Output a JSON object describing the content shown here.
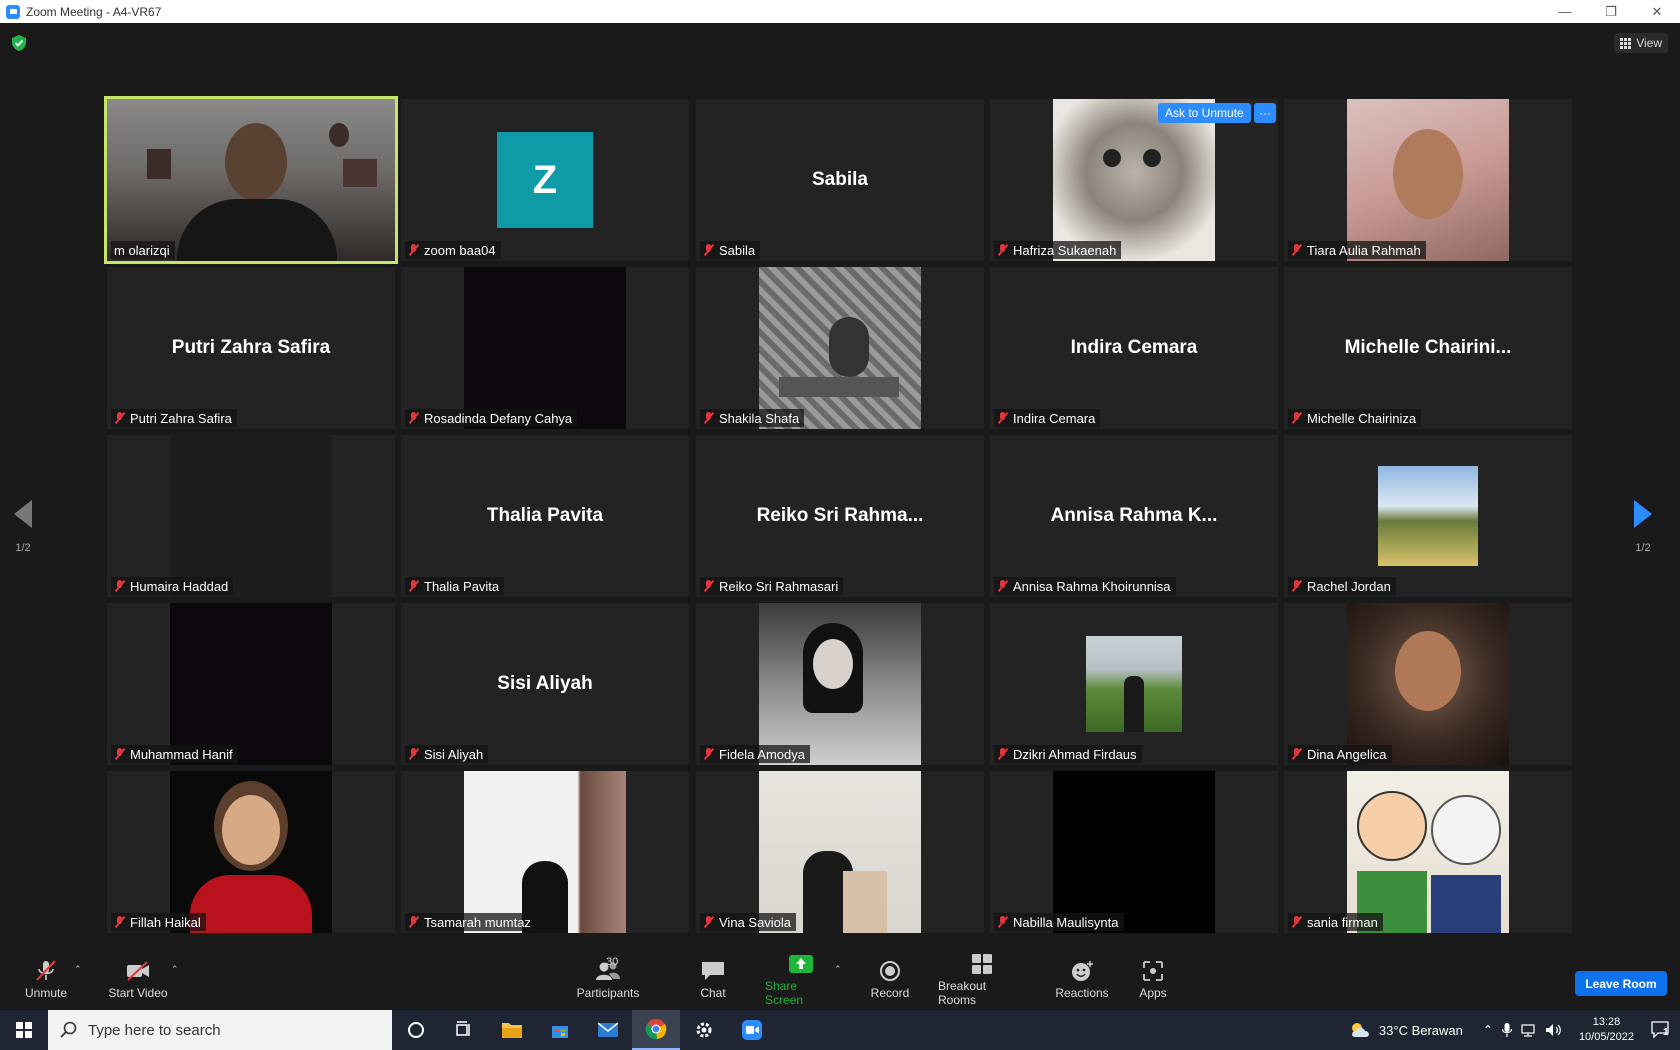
{
  "window": {
    "title": "Zoom Meeting - A4-VR67"
  },
  "top": {
    "view_label": "View"
  },
  "pagination": {
    "left": "1/2",
    "right": "1/2"
  },
  "tiles": [
    {
      "name": "m olarizqi",
      "center": "",
      "muted": false
    },
    {
      "name": "zoom baa04",
      "center": "",
      "avatar": "Z",
      "muted": true
    },
    {
      "name": "Sabila",
      "center": "Sabila",
      "muted": true
    },
    {
      "name": "Hafriza Sukaenah",
      "center": "",
      "muted": true,
      "ask_unmute": "Ask to Unmute",
      "more": "···"
    },
    {
      "name": "Tiara Aulia Rahmah",
      "center": "",
      "muted": true
    },
    {
      "name": "Putri Zahra Safira",
      "center": "Putri Zahra Safira",
      "muted": true
    },
    {
      "name": "Rosadinda Defany Cahya",
      "center": "",
      "muted": true
    },
    {
      "name": "Shakila Shafa",
      "center": "",
      "muted": true
    },
    {
      "name": "Indira Cemara",
      "center": "Indira Cemara",
      "muted": true
    },
    {
      "name": "Michelle Chairiniza",
      "center": "Michelle  Chairini...",
      "muted": true
    },
    {
      "name": "Humaira Haddad",
      "center": "",
      "muted": true
    },
    {
      "name": "Thalia Pavita",
      "center": "Thalia Pavita",
      "muted": true
    },
    {
      "name": "Reiko Sri Rahmasari",
      "center": "Reiko  Sri  Rahma...",
      "muted": true
    },
    {
      "name": "Annisa Rahma Khoirunnisa",
      "center": "Annisa  Rahma  K...",
      "muted": true
    },
    {
      "name": "Rachel Jordan",
      "center": "",
      "muted": true
    },
    {
      "name": "Muhammad Hanif",
      "center": "",
      "muted": true
    },
    {
      "name": "Sisi Aliyah",
      "center": "Sisi Aliyah",
      "muted": true
    },
    {
      "name": "Fidela Amodya",
      "center": "",
      "muted": true
    },
    {
      "name": "Dzikri Ahmad Firdaus",
      "center": "",
      "muted": true
    },
    {
      "name": "Dina Angelica",
      "center": "",
      "muted": true
    },
    {
      "name": "Fillah Haikal",
      "center": "",
      "muted": true
    },
    {
      "name": "Tsamarah mumtaz",
      "center": "",
      "muted": true
    },
    {
      "name": "Vina Saviola",
      "center": "",
      "muted": true
    },
    {
      "name": "Nabilla Maulisynta",
      "center": "",
      "muted": true
    },
    {
      "name": "sania firman",
      "center": "",
      "muted": true
    }
  ],
  "toolbar": {
    "unmute": "Unmute",
    "start_video": "Start Video",
    "participants": "Participants",
    "participants_count": "30",
    "chat": "Chat",
    "share_screen": "Share Screen",
    "record": "Record",
    "breakout_rooms": "Breakout Rooms",
    "reactions": "Reactions",
    "apps": "Apps",
    "leave_room": "Leave Room"
  },
  "taskbar": {
    "search_placeholder": "Type here to search",
    "weather": "33°C  Berawan",
    "time": "13:28",
    "date": "10/05/2022",
    "notifications": "1"
  },
  "colors": {
    "accent": "#2d8cff",
    "active_speaker": "#c6e56b",
    "muted": "#e0383e",
    "share": "#1fb43a"
  }
}
